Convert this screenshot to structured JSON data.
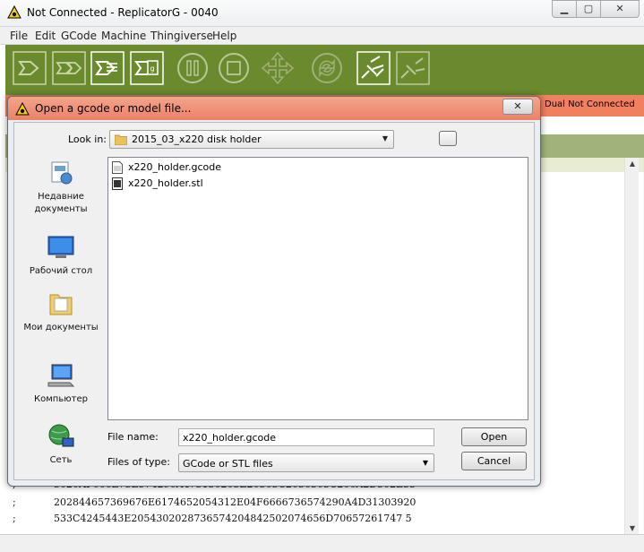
{
  "window": {
    "title": "Not Connected - ReplicatorG - 0040",
    "min_glyph": "▁",
    "max_glyph": "▢",
    "close_glyph": "✕"
  },
  "menu": [
    "File",
    "Edit",
    "GCode",
    "Machine",
    "Thingiverse",
    "Help"
  ],
  "toolbar": {
    "icons": [
      "build-icon",
      "upload-icon",
      "generate-gcode-icon",
      "build-file-icon",
      "pause-icon",
      "stop-icon",
      "jog-icon",
      "reset-icon",
      "connect-icon",
      "disconnect-icon"
    ]
  },
  "status": {
    "right_text": "Dual Not Connected",
    "color": "#f08060"
  },
  "console": {
    "lines": [
      {
        "prefix": ";",
        "text": "3020AF666E73E574290A473130203E20303C2036303C206A2D302E33"
      },
      {
        "prefix": ";",
        "text": "202844657369676E6174652054312E04F6666736574290A4D31303920"
      },
      {
        "prefix": ";",
        "text": "533C4245443E2054302028736574204842502074656D70657261747 5"
      }
    ]
  },
  "dialog": {
    "title": "Open a gcode or model file...",
    "close_glyph": "✕",
    "look_in_label": "Look in:",
    "look_in_value": "2015_03_x220 disk holder",
    "places": [
      {
        "label": "Недавние документы",
        "icon": "recent-documents-icon"
      },
      {
        "label": "Рабочий стол",
        "icon": "desktop-icon"
      },
      {
        "label": "Мои документы",
        "icon": "my-documents-icon"
      },
      {
        "label": "Компьютер",
        "icon": "computer-icon"
      },
      {
        "label": "Сеть",
        "icon": "network-icon"
      }
    ],
    "files": [
      {
        "name": "x220_holder.gcode",
        "icon": "gcode-file-icon"
      },
      {
        "name": "x220_holder.stl",
        "icon": "stl-file-icon"
      }
    ],
    "file_name_label": "File name:",
    "file_name_value": "x220_holder.gcode",
    "file_type_label": "Files of type:",
    "file_type_value": "GCode or STL files",
    "open_button": "Open",
    "cancel_button": "Cancel"
  },
  "colors": {
    "toolbar": "#6b8a2e",
    "dialog_title": "#ea8266"
  }
}
